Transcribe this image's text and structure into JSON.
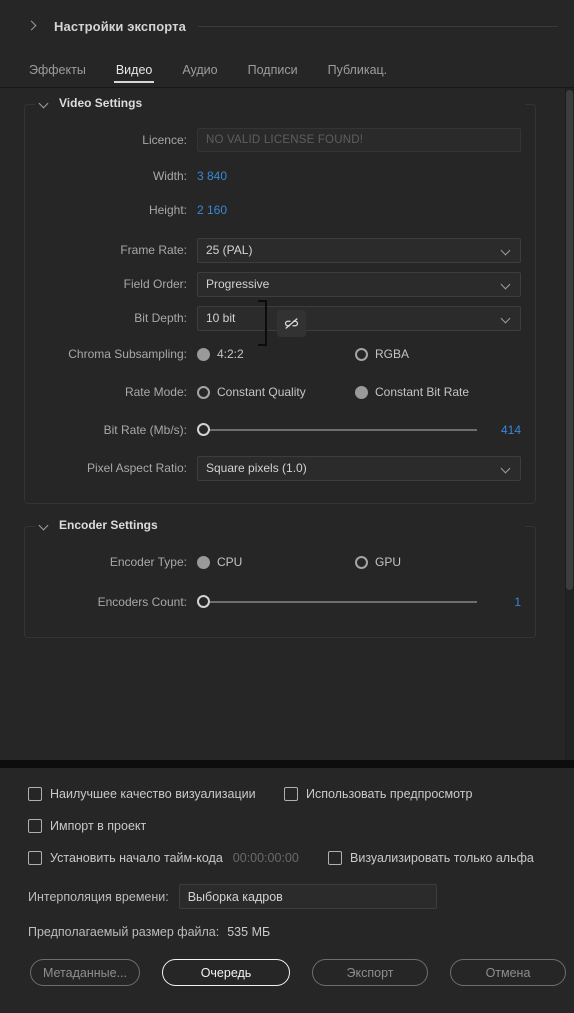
{
  "header": {
    "title": "Настройки экспорта",
    "collapse_icon": "chevron-right-icon"
  },
  "tabs": [
    {
      "label": "Эффекты",
      "active": false
    },
    {
      "label": "Видео",
      "active": true
    },
    {
      "label": "Аудио",
      "active": false
    },
    {
      "label": "Подписи",
      "active": false
    },
    {
      "label": "Публикац.",
      "active": false
    }
  ],
  "video_settings": {
    "title": "Video Settings",
    "licence": {
      "label": "Licence:",
      "value": "NO VALID LICENSE FOUND!"
    },
    "width": {
      "label": "Width:",
      "value": "3 840"
    },
    "height": {
      "label": "Height:",
      "value": "2 160"
    },
    "link_toggle": {
      "icon": "unlink-icon",
      "state": "unlinked"
    },
    "frame_rate": {
      "label": "Frame Rate:",
      "value": "25 (PAL)"
    },
    "field_order": {
      "label": "Field Order:",
      "value": "Progressive"
    },
    "bit_depth": {
      "label": "Bit Depth:",
      "value": "10 bit"
    },
    "chroma_subsampling": {
      "label": "Chroma Subsampling:",
      "options": [
        {
          "label": "4:2:2",
          "selected": true
        },
        {
          "label": "RGBA",
          "selected": false
        }
      ]
    },
    "rate_mode": {
      "label": "Rate Mode:",
      "options": [
        {
          "label": "Constant Quality",
          "selected": false
        },
        {
          "label": "Constant Bit Rate",
          "selected": true
        }
      ]
    },
    "bit_rate": {
      "label": "Bit Rate (Mb/s):",
      "value": "414",
      "slider_percent": 0
    },
    "pixel_aspect_ratio": {
      "label": "Pixel Aspect Ratio:",
      "value": "Square pixels (1.0)"
    }
  },
  "encoder_settings": {
    "title": "Encoder Settings",
    "encoder_type": {
      "label": "Encoder Type:",
      "options": [
        {
          "label": "CPU",
          "selected": true
        },
        {
          "label": "GPU",
          "selected": false
        }
      ]
    },
    "encoders_count": {
      "label": "Encoders Count:",
      "value": "1",
      "slider_percent": 0
    }
  },
  "bottom": {
    "checkboxes": [
      {
        "label": "Наилучшее качество визуализации",
        "checked": false
      },
      {
        "label": "Использовать предпросмотр",
        "checked": false
      },
      {
        "label": "Импорт в проект",
        "checked": false
      },
      {
        "label": "Установить начало тайм-кода",
        "checked": false
      },
      {
        "label": "Визуализировать только альфа",
        "checked": false
      }
    ],
    "timecode": "00:00:00:00",
    "time_interpolation": {
      "label": "Интерполяция времени:",
      "value": "Выборка кадров"
    },
    "file_size": {
      "label": "Предполагаемый размер файла:",
      "value": "535 МБ"
    },
    "buttons": {
      "metadata": "Метаданные...",
      "queue": "Очередь",
      "export": "Экспорт",
      "cancel": "Отмена"
    }
  },
  "colors": {
    "background": "#262626",
    "accent_blue": "#3a87d4",
    "primary_button_border": "#f2f2f2"
  }
}
